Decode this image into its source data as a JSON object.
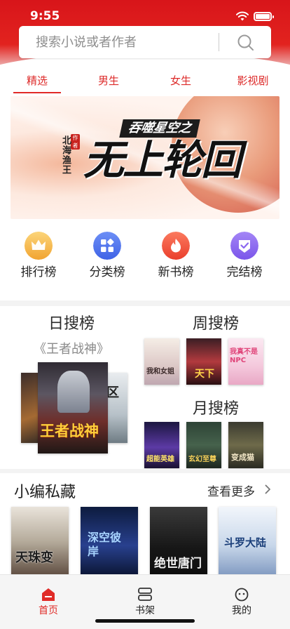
{
  "status_bar": {
    "time": "9:55"
  },
  "search": {
    "placeholder": "搜索小说或者作者"
  },
  "tabs": [
    {
      "label": "精选",
      "active": true
    },
    {
      "label": "男生",
      "active": false
    },
    {
      "label": "女生",
      "active": false
    },
    {
      "label": "影视剧",
      "active": false
    }
  ],
  "banner": {
    "tagline": "吞噬星空之",
    "title": "无上轮回",
    "author": "北海渔王",
    "seal": "作者"
  },
  "quick_links": [
    {
      "label": "排行榜",
      "icon": "crown-icon",
      "color": "#f6b73c"
    },
    {
      "label": "分类榜",
      "icon": "grid-icon",
      "color": "#4f74f0"
    },
    {
      "label": "新书榜",
      "icon": "flame-icon",
      "color": "#f2583f"
    },
    {
      "label": "完结榜",
      "icon": "check-shield-icon",
      "color": "#8b67f0"
    }
  ],
  "daily_rank": {
    "title": "日搜榜",
    "featured": "《王者战神》",
    "covers": [
      "王者战神"
    ]
  },
  "weekly_rank": {
    "title": "周搜榜",
    "covers": [
      "我和女姐",
      "天下",
      "我真不是NPC"
    ]
  },
  "monthly_rank": {
    "title": "月搜榜",
    "covers": [
      "超能英雄",
      "玄幻至尊",
      "变成猫"
    ]
  },
  "picks": {
    "title": "小编私藏",
    "more": "查看更多",
    "covers": [
      "天珠变",
      "深空彼岸",
      "绝世唐门",
      "斗罗大陆"
    ]
  },
  "tabbar": [
    {
      "label": "首页",
      "icon": "home-icon",
      "active": true
    },
    {
      "label": "书架",
      "icon": "bookshelf-icon",
      "active": false
    },
    {
      "label": "我的",
      "icon": "profile-icon",
      "active": false
    }
  ],
  "colors": {
    "brand_red": "#e02b27",
    "header_red": "#d8151a"
  }
}
